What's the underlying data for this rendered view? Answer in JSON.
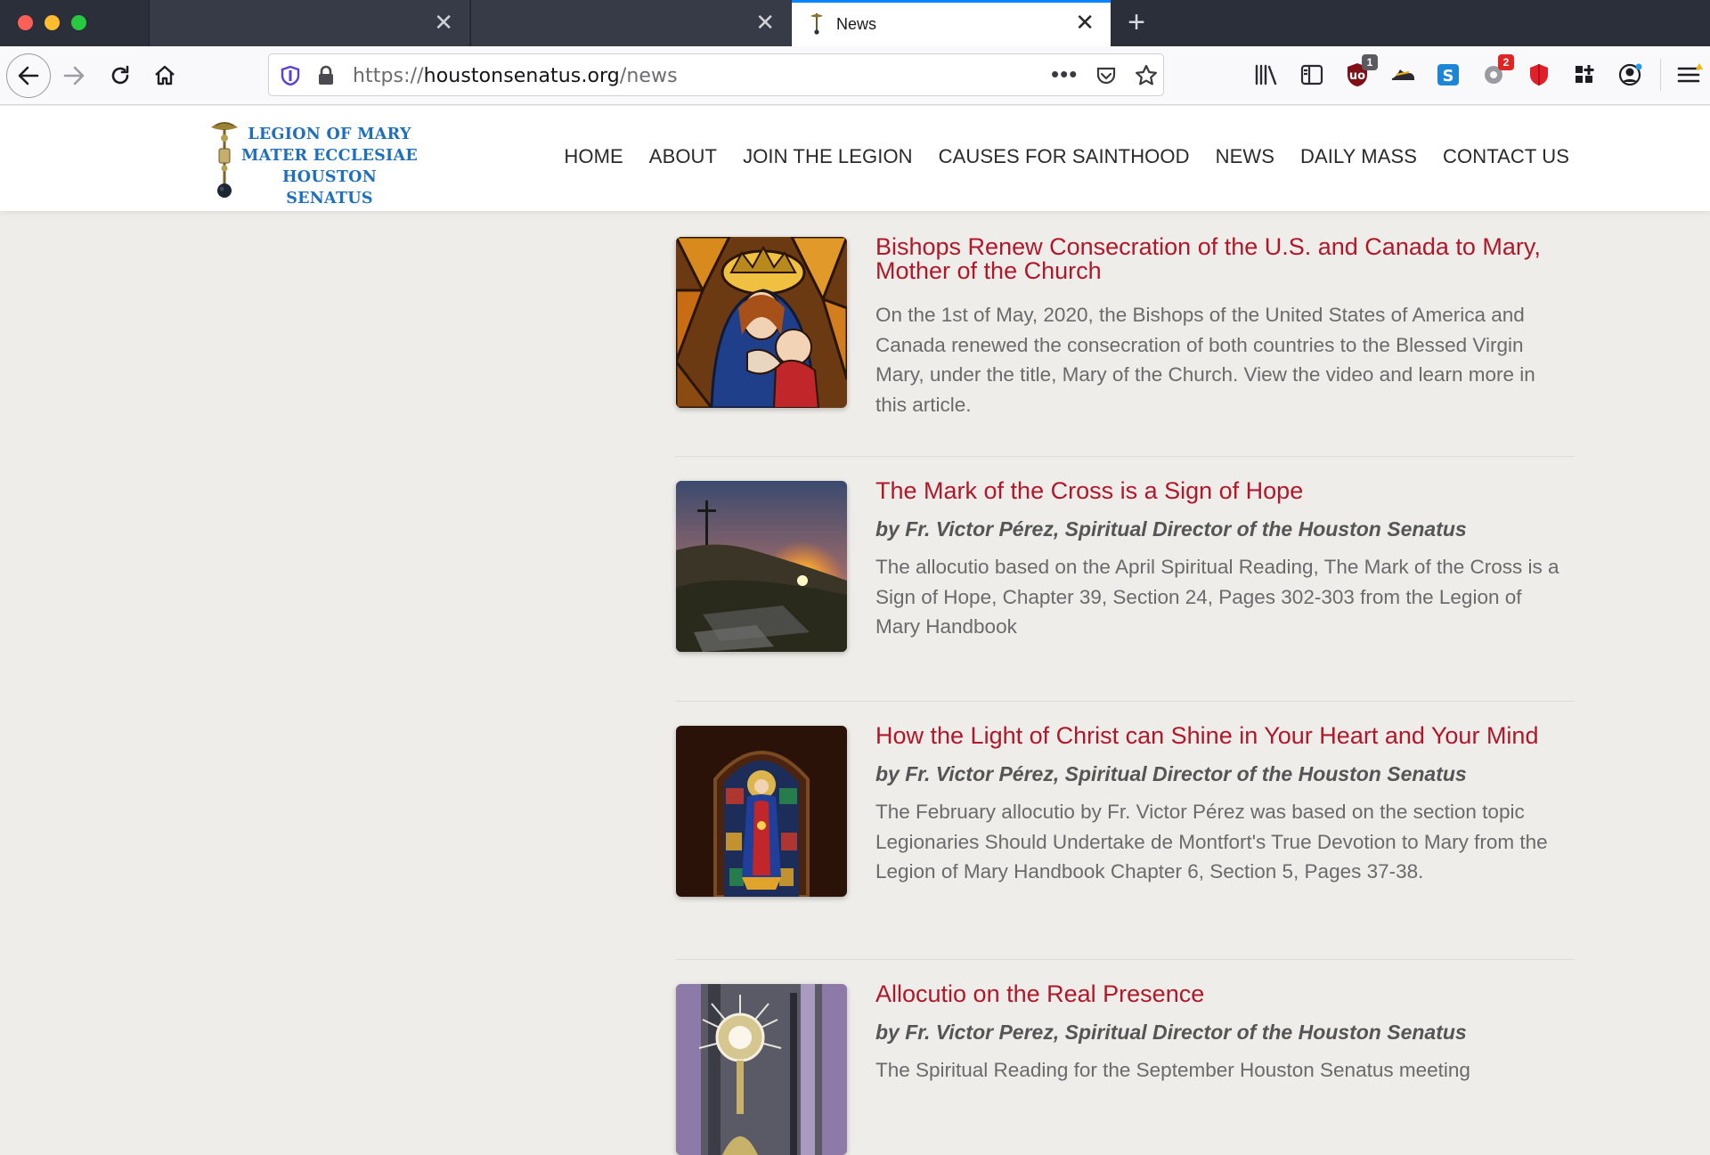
{
  "browser": {
    "tabs": [
      {
        "title": "",
        "active": false
      },
      {
        "title": "",
        "active": false
      },
      {
        "title": "News",
        "active": true
      }
    ],
    "url": {
      "prefix": "https://",
      "host": "houstonsenatus.org",
      "path": "/news"
    },
    "badges": {
      "ublock": "1",
      "ext2": "2"
    },
    "accent": "#0a84ff"
  },
  "site": {
    "logo_lines": [
      "LEGION OF MARY",
      "MATER ECCLESIAE",
      "HOUSTON SENATUS"
    ],
    "nav": [
      "HOME",
      "ABOUT",
      "JOIN THE LEGION",
      "CAUSES FOR SAINTHOOD",
      "NEWS",
      "DAILY MASS",
      "CONTACT US"
    ],
    "title_color": "#b0182a"
  },
  "posts": [
    {
      "title": "Bishops Renew Consecration of the U.S. and Canada to Mary, Mother of the Church",
      "byline": "",
      "excerpt": "On the 1st of May, 2020, the Bishops of the United States of America and Canada renewed the consecration of both countries to the Blessed Virgin Mary, under the title, Mary of the Church. View the video and learn more in this article.",
      "image": "stained-glass-madonna-and-child"
    },
    {
      "title": "The Mark of the Cross is a Sign of Hope",
      "byline": "by Fr. Victor Pérez, Spiritual Director of the Houston Senatus",
      "excerpt": "The allocutio based on the April Spiritual Reading, The Mark of the Cross is a Sign of Hope, Chapter 39, Section 24, Pages 302-303 from the Legion of Mary Handbook",
      "image": "cross-on-hill-at-sunset"
    },
    {
      "title": "How the Light of Christ can Shine in Your Heart and Your Mind",
      "byline": "by Fr. Victor Pérez, Spiritual Director of the Houston Senatus",
      "excerpt": "The February allocutio by Fr. Victor Pérez was based on the section topic Legionaries Should Undertake de Montfort's True Devotion to Mary from the Legion of Mary Handbook Chapter 6, Section 5, Pages 37-38.",
      "image": "stained-glass-window-mary"
    },
    {
      "title": "Allocutio on the Real Presence",
      "byline": "by Fr. Victor Perez, Spiritual Director of the Houston Senatus",
      "excerpt": "The Spiritual Reading for the September Houston Senatus meeting",
      "image": "monstrance"
    }
  ]
}
